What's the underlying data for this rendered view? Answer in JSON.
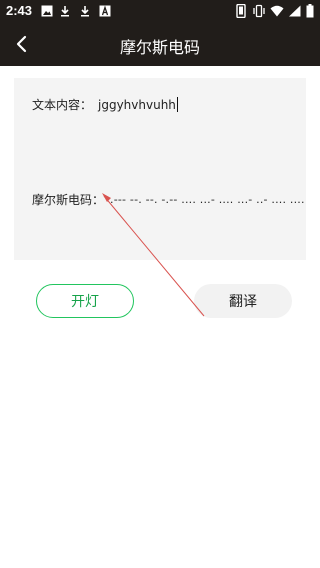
{
  "status_bar": {
    "time": "2:43",
    "icons": [
      "image-icon",
      "download-icon",
      "download-icon",
      "font-icon",
      "phone-icon",
      "vibrate-icon",
      "wifi-icon",
      "signal-icon",
      "battery-icon"
    ]
  },
  "app_bar": {
    "title": "摩尔斯电码",
    "back_icon": "back-arrow-icon"
  },
  "panel": {
    "text_label": "文本内容：",
    "text_value": "jggyhvhvuhh",
    "morse_label": "摩尔斯电码：",
    "morse_value": ".--- --. --. -.-- .... ...- .... ...- ..- .... ...."
  },
  "buttons": {
    "light_label": "开灯",
    "translate_label": "翻译"
  },
  "colors": {
    "bar_bg": "#211d1a",
    "accent_green": "#22c55e",
    "panel_bg": "#f4f4f4",
    "annotation_red": "#d9534f"
  }
}
